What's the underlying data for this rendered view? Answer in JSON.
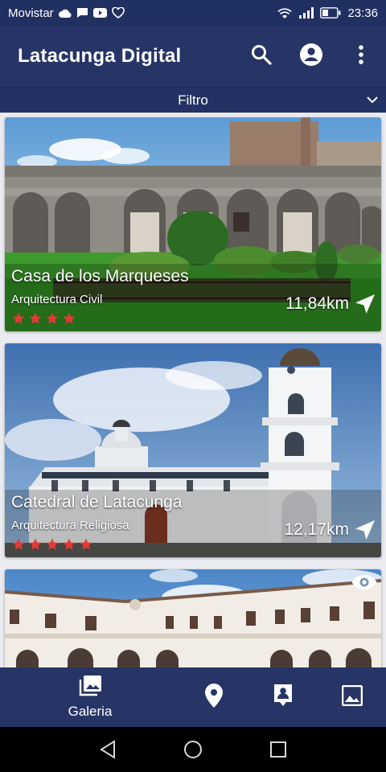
{
  "status_bar": {
    "carrier": "Movistar",
    "time": "23:36"
  },
  "app_bar": {
    "title": "Latacunga Digital"
  },
  "filter": {
    "label": "Filtro"
  },
  "cards": [
    {
      "name": "Casa de los Marqueses",
      "category": "Arquitectura Civil",
      "distance": "11,84km",
      "rating": 4
    },
    {
      "name": "Catedral de Latacunga",
      "category": "Arquitectura Religiosa",
      "distance": "12,17km",
      "rating": 5
    },
    {
      "name": "",
      "category": "",
      "distance": "",
      "rating": 0
    }
  ],
  "bottom_nav": {
    "items": [
      {
        "label": "Galeria",
        "icon": "gallery-icon",
        "active": true
      },
      {
        "label": "",
        "icon": "location-pin-icon",
        "active": false
      },
      {
        "label": "",
        "icon": "contact-card-icon",
        "active": false
      },
      {
        "label": "",
        "icon": "image-icon",
        "active": false
      }
    ]
  },
  "colors": {
    "primary": "#263565",
    "star": "#e53935",
    "text_on_primary": "#ffffff"
  }
}
